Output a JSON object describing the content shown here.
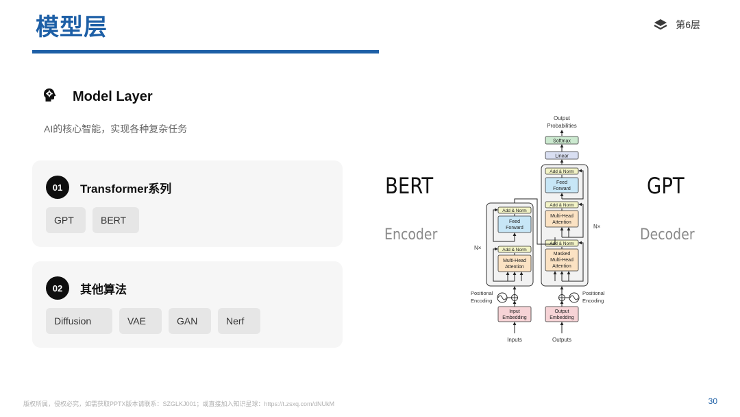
{
  "header": {
    "title": "模型层",
    "layer_label": "第6层",
    "layer_icon": "layers-icon"
  },
  "section": {
    "icon": "brain-gear-icon",
    "heading": "Model Layer",
    "subtitle": "AI的核心智能，实现各种复杂任务"
  },
  "cards": [
    {
      "number": "01",
      "title": "Transformer系列",
      "chips": [
        "GPT",
        "BERT"
      ]
    },
    {
      "number": "02",
      "title": "其他算法",
      "chips": [
        "Diffusion",
        "VAE",
        "GAN",
        "Nerf"
      ]
    }
  ],
  "diagram": {
    "left_big": "BERT",
    "left_small": "Encoder",
    "right_big": "GPT",
    "right_small": "Decoder",
    "output_probs_1": "Output",
    "output_probs_2": "Probabilities",
    "softmax": "Softmax",
    "linear": "Linear",
    "add_norm": "Add & Norm",
    "feed_1": "Feed",
    "feed_2": "Forward",
    "mha_1": "Multi-Head",
    "mha_2": "Attention",
    "masked": "Masked",
    "nx": "N×",
    "pos_1": "Positional",
    "pos_2": "Encoding",
    "input_emb_1": "Input",
    "input_emb_2": "Embedding",
    "output_emb_1": "Output",
    "output_emb_2": "Embedding",
    "inputs": "Inputs",
    "outputs": "Outputs"
  },
  "colors": {
    "accent": "#1d5fa6",
    "card_bg": "#f6f6f6",
    "chip_bg": "#e6e6e6",
    "feed_forward": "#c7e6f6",
    "attention": "#fbe2c3",
    "add_norm": "#f2f3c6",
    "embedding": "#f6d3d6",
    "softmax": "#cbe9cf",
    "linear": "#d9dff2"
  },
  "footer": {
    "copyright": "版权所属，侵权必究，如需获取PPTX版本请联系：SZGLKJ001；或直接加入知识星球：https://t.zsxq.com/dNUkM",
    "page_number": "30"
  }
}
